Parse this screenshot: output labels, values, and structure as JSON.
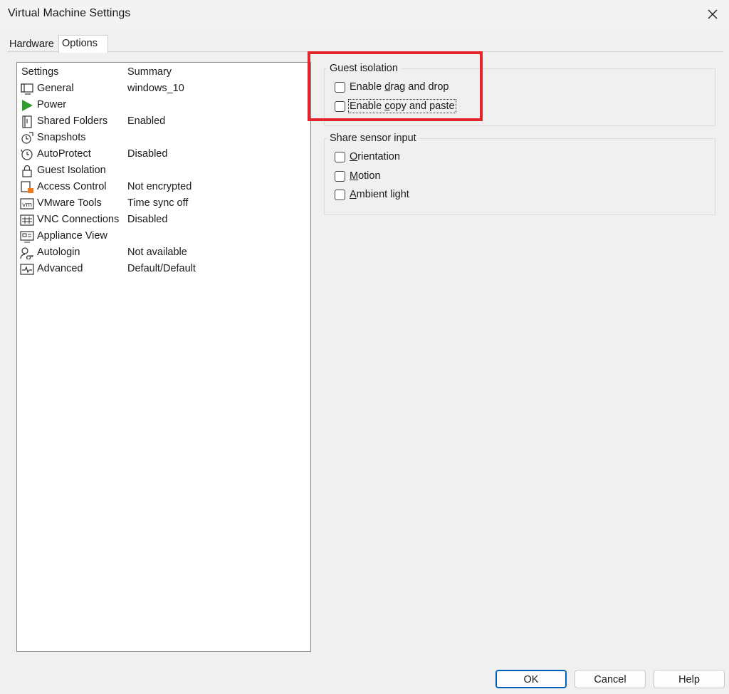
{
  "window": {
    "title": "Virtual Machine Settings"
  },
  "tabs": [
    {
      "label": "Hardware"
    },
    {
      "label": "Options"
    }
  ],
  "list": {
    "col_settings": "Settings",
    "col_summary": "Summary",
    "items": [
      {
        "name": "General",
        "summary": "windows_10",
        "icon": "monitor-icon"
      },
      {
        "name": "Power",
        "summary": "",
        "icon": "play-icon"
      },
      {
        "name": "Shared Folders",
        "summary": "Enabled",
        "icon": "shared-folder-icon"
      },
      {
        "name": "Snapshots",
        "summary": "",
        "icon": "snapshot-icon"
      },
      {
        "name": "AutoProtect",
        "summary": "Disabled",
        "icon": "clock-icon"
      },
      {
        "name": "Guest Isolation",
        "summary": "",
        "icon": "lock-icon"
      },
      {
        "name": "Access Control",
        "summary": "Not encrypted",
        "icon": "access-control-icon"
      },
      {
        "name": "VMware Tools",
        "summary": "Time sync off",
        "icon": "vmware-icon"
      },
      {
        "name": "VNC Connections",
        "summary": "Disabled",
        "icon": "network-icon"
      },
      {
        "name": "Appliance View",
        "summary": "",
        "icon": "appliance-icon"
      },
      {
        "name": "Autologin",
        "summary": "Not available",
        "icon": "user-key-icon"
      },
      {
        "name": "Advanced",
        "summary": "Default/Default",
        "icon": "pulse-icon"
      }
    ]
  },
  "guest_isolation": {
    "label": "Guest isolation",
    "drag_pre": "Enable ",
    "drag_u": "d",
    "drag_post": "rag and drop",
    "copy_pre": "Enable ",
    "copy_u": "c",
    "copy_post": "opy and paste",
    "drag_checked": false,
    "copy_checked": false
  },
  "sensor": {
    "label": "Share sensor input",
    "orient_u": "O",
    "orient_post": "rientation",
    "motion_u": "M",
    "motion_post": "otion",
    "ambient_u": "A",
    "ambient_post": "mbient light"
  },
  "buttons": {
    "ok": "OK",
    "cancel": "Cancel",
    "help": "Help"
  },
  "colors": {
    "highlight": "#e3262c",
    "power_green": "#2e9e2e",
    "ok_border": "#005fb8"
  }
}
